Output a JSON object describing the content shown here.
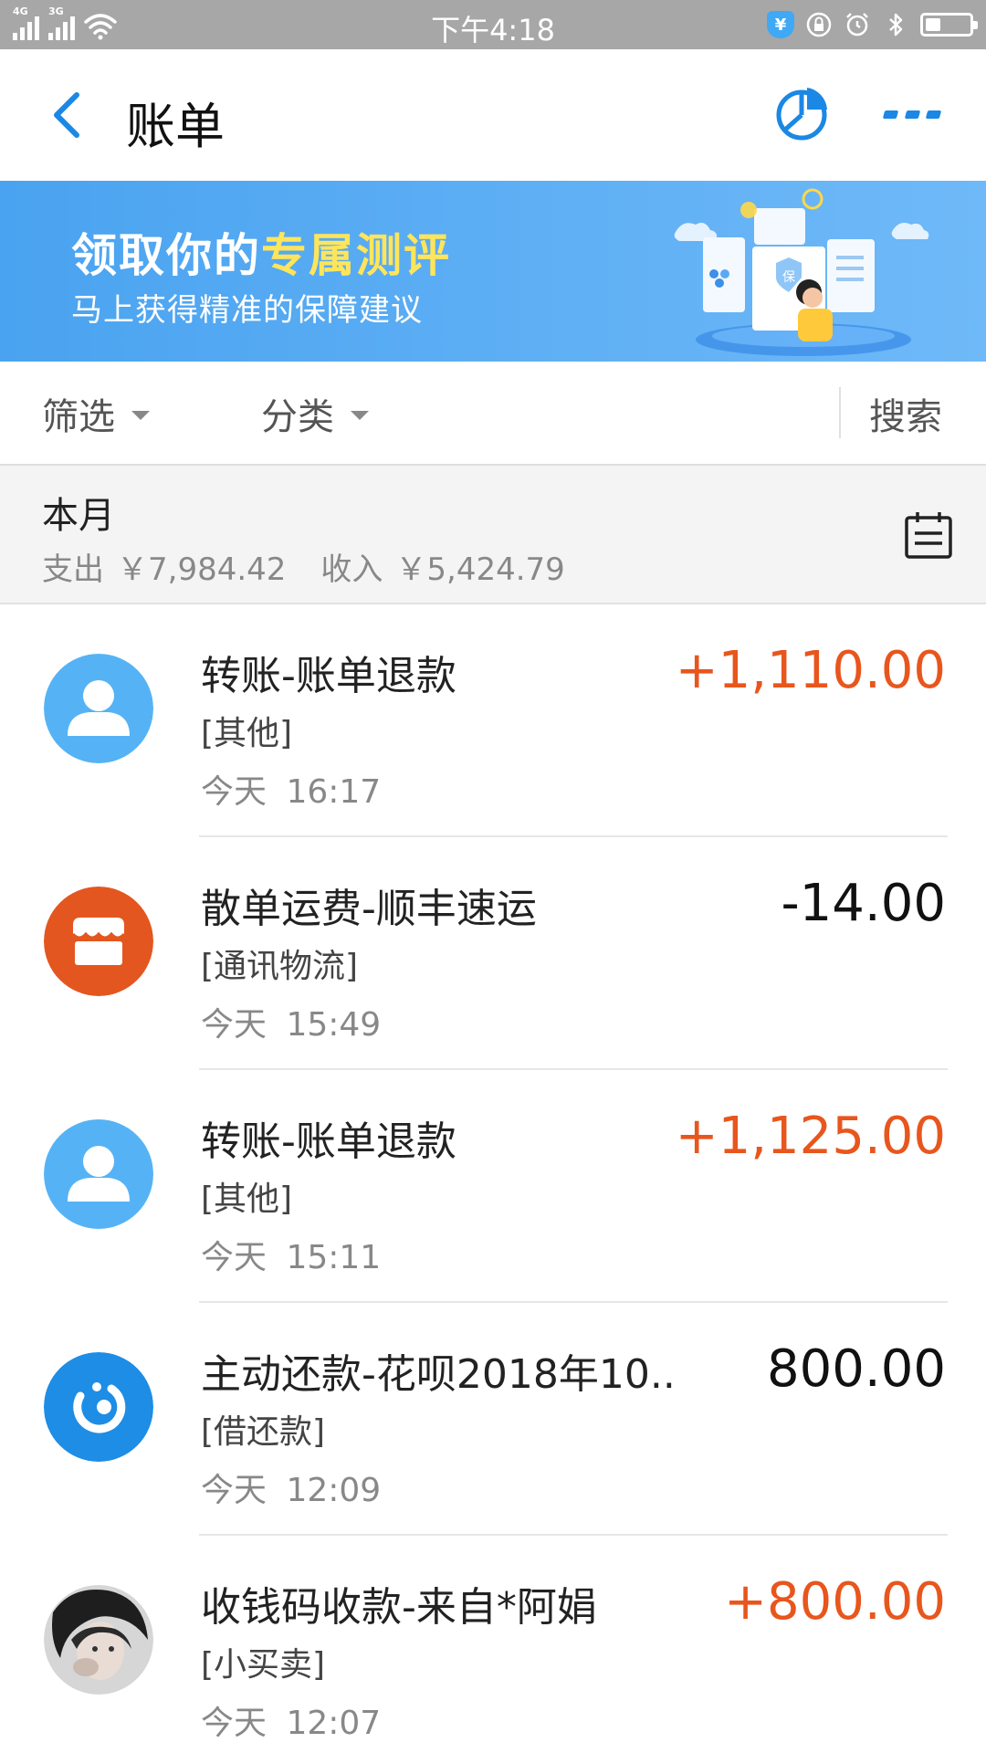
{
  "status_bar": {
    "time": "下午4:18",
    "signal_1_label": "4G",
    "signal_2_label": "3G",
    "icons": [
      "shield-yen-icon",
      "lock-rotation-icon",
      "alarm-icon",
      "bluetooth-icon",
      "battery-icon"
    ],
    "battery_level": 0.35,
    "shield_glyph": "¥"
  },
  "nav": {
    "title": "账单",
    "back_icon": "chevron-left-icon",
    "chart_icon": "pie-chart-icon",
    "more_icon": "more-icon",
    "accent_color": "#1a88e4"
  },
  "banner": {
    "title_plain": "领取你的",
    "title_highlight": "专属测评",
    "subtitle": "马上获得精准的保障建议",
    "art_badge": "保"
  },
  "filters": {
    "filter_label": "筛选",
    "category_label": "分类",
    "search_label": "搜索"
  },
  "month": {
    "title": "本月",
    "expense_label": "支出",
    "expense_value": "￥7,984.42",
    "income_label": "收入",
    "income_value": "￥5,424.79",
    "calendar_icon": "calendar-icon"
  },
  "transactions": [
    {
      "title": "转账-账单退款",
      "category": "[其他]",
      "time": "今天 16:17",
      "amount": "+1,110.00",
      "type": "income",
      "icon": "person-icon"
    },
    {
      "title": "散单运费-顺丰速运",
      "category": "[通讯物流]",
      "time": "今天 15:49",
      "amount": "-14.00",
      "type": "expense",
      "icon": "shop-icon"
    },
    {
      "title": "转账-账单退款",
      "category": "[其他]",
      "time": "今天 15:11",
      "amount": "+1,125.00",
      "type": "income",
      "icon": "person-icon"
    },
    {
      "title": "主动还款-花呗2018年10...",
      "category": "[借还款]",
      "time": "今天 12:09",
      "amount": "800.00",
      "type": "neutral",
      "icon": "huabei-icon"
    },
    {
      "title": "收钱码收款-来自*阿娟",
      "category": "[小买卖]",
      "time": "今天 12:07",
      "amount": "+800.00",
      "type": "income",
      "icon": "user-photo-avatar"
    }
  ]
}
